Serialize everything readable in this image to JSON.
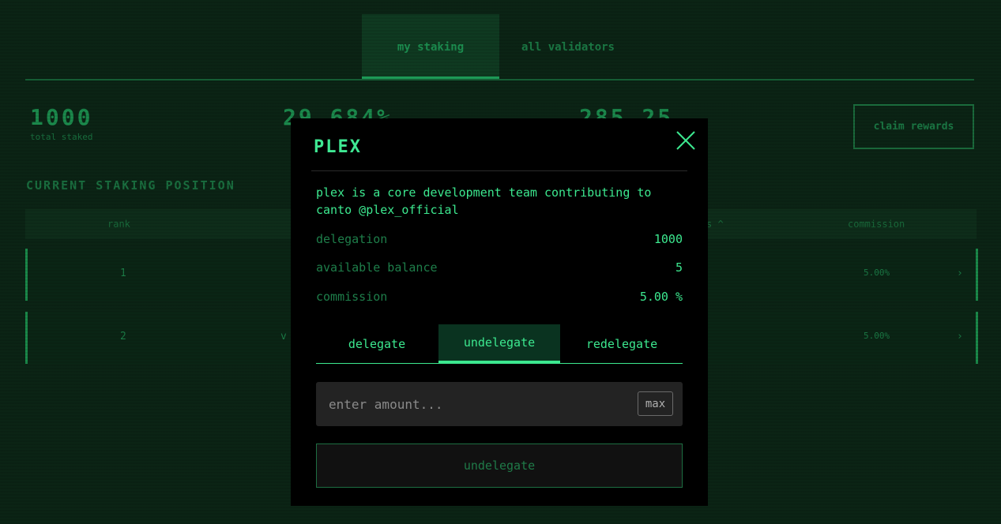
{
  "background": {
    "tabs": [
      "my staking",
      "all validators"
    ],
    "stats": [
      {
        "value": "1000",
        "label": "total staked"
      },
      {
        "value": "29.684%",
        "label": ""
      },
      {
        "value": "285.25",
        "label": ""
      }
    ],
    "claim_button": "claim rewards",
    "section_title": "CURRENT STAKING POSITION",
    "table_headers": {
      "rank": "rank",
      "staked": "s ^",
      "commission": "commission"
    },
    "rows": [
      {
        "rank": "1",
        "name": "",
        "commission": "5.00%"
      },
      {
        "rank": "2",
        "name": "v",
        "commission": "5.00%"
      }
    ]
  },
  "modal": {
    "title": "PLEX",
    "description": "plex is a core development team contributing to canto @plex_official",
    "info": [
      {
        "key": "delegation",
        "value": "1000"
      },
      {
        "key": "available balance",
        "value": "5"
      },
      {
        "key": "commission",
        "value": "5.00 %"
      }
    ],
    "tabs": [
      "delegate",
      "undelegate",
      "redelegate"
    ],
    "active_tab": "undelegate",
    "amount_placeholder": "enter amount...",
    "max_label": "max",
    "action_button": "undelegate"
  },
  "colors": {
    "accent": "#3ce88f",
    "background": "#0b2415",
    "modal_bg": "#000000"
  }
}
